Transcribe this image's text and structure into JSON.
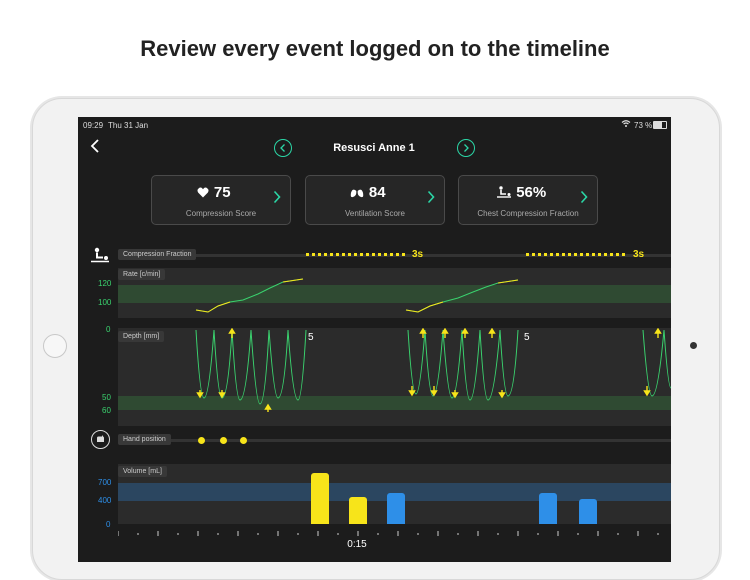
{
  "headline": "Review every event logged on to the timeline",
  "status": {
    "time": "09:29",
    "date": "Thu 31 Jan",
    "battery": "73 %"
  },
  "nav": {
    "title": "Resusci Anne 1",
    "back_icon": "chevron-left-icon",
    "prev_icon": "chevron-left-icon",
    "next_icon": "chevron-right-icon"
  },
  "cards": [
    {
      "icon": "heart-icon",
      "value": "75",
      "label": "Compression Score"
    },
    {
      "icon": "lungs-icon",
      "value": "84",
      "label": "Ventilation Score"
    },
    {
      "icon": "cpr-icon",
      "value": "56%",
      "label": "Chest Compression Fraction"
    }
  ],
  "compression_fraction": {
    "label": "Compression Fraction",
    "pause_1": "3s",
    "pause_2": "3s"
  },
  "rate": {
    "label": "Rate [c/min]",
    "ticks": [
      "120",
      "100"
    ]
  },
  "depth": {
    "label": "Depth [mm]",
    "ticks": [
      "0",
      "50",
      "60"
    ],
    "count_1": "5",
    "count_2": "5"
  },
  "hand_position": {
    "label": "Hand position"
  },
  "volume": {
    "label": "Volume [mL]",
    "ticks": [
      "700",
      "400",
      "0"
    ]
  },
  "timeline": {
    "time_label": "0:15"
  },
  "colors": {
    "accent": "#2bd6a6",
    "yellow": "#f7e41a",
    "blue": "#2e8fe8",
    "green_band": "#2f4a32",
    "blue_band": "#2b4660"
  }
}
